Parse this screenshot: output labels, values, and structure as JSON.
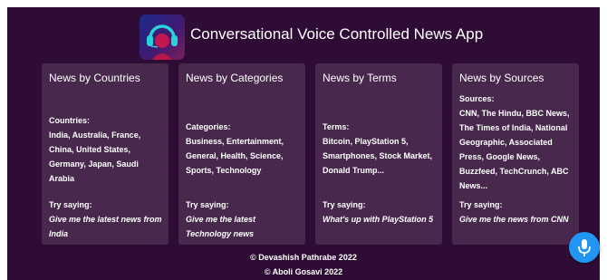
{
  "app": {
    "title": "Conversational Voice Controlled News App",
    "logo_icon": "headset-head-icon",
    "bg": "#2e0b34"
  },
  "cards": [
    {
      "title": "News by Countries",
      "body": "Countries:\nIndia, Australia, France, China, United States, Germany, Japan, Saudi Arabia",
      "try_label": "Try saying:",
      "try_example": "Give me the latest news from India"
    },
    {
      "title": "News by Categories",
      "body": "Categories:\nBusiness, Entertainment, General, Health, Science, Sports, Technology",
      "try_label": "Try saying:",
      "try_example": "Give me the latest Technology news"
    },
    {
      "title": "News by Terms",
      "body": "Terms:\nBitcoin, PlayStation 5, Smartphones, Stock Market, Donald Trump...",
      "try_label": "Try saying:",
      "try_example": "What's up with PlayStation 5"
    },
    {
      "title": "News by Sources",
      "body": "Sources:\nCNN, The Hindu, BBC News, The Times of India, National Geographic, Associated Press, Google News, Buzzfeed, TechCrunch, ABC News...",
      "try_label": "Try saying:",
      "try_example": "Give me the news from CNN"
    }
  ],
  "footer": {
    "line1": "© Devashish Pathrabe 2022",
    "line2": "© Aboli Gosavi 2022"
  },
  "mic": {
    "icon": "microphone-icon",
    "color": "#2196f3"
  }
}
